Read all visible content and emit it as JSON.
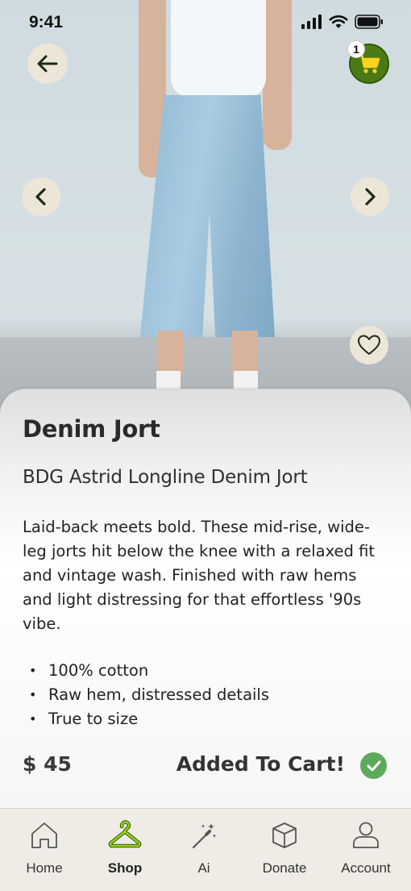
{
  "status_bar": {
    "time": "9:41"
  },
  "header": {
    "cart_count": "1"
  },
  "product": {
    "title": "Denim Jort",
    "name": "BDG Astrid Longline Denim Jort",
    "description": "Laid-back meets bold. These mid-rise, wide-leg jorts hit below the knee with a relaxed fit and vintage wash. Finished with raw hems and light distressing for that effortless '90s vibe.",
    "features": [
      "100% cotton",
      "Raw hem, distressed details",
      "True to size"
    ],
    "price": "$ 45",
    "cart_status": "Added To Cart!",
    "favorited": false
  },
  "icons": {
    "back": "arrow-left-icon",
    "prev": "chevron-left-icon",
    "next": "chevron-right-icon",
    "cart": "shopping-cart-icon",
    "favorite": "heart-icon",
    "added": "check-circle-icon"
  },
  "nav": {
    "active": "Shop",
    "items": [
      {
        "label": "Home",
        "icon": "home-icon"
      },
      {
        "label": "Shop",
        "icon": "hanger-icon"
      },
      {
        "label": "Ai",
        "icon": "magic-wand-icon"
      },
      {
        "label": "Donate",
        "icon": "box-icon"
      },
      {
        "label": "Account",
        "icon": "user-icon"
      }
    ]
  },
  "colors": {
    "accent_green": "#4b7a14",
    "hanger_green": "#9bd11d",
    "check_green": "#5daa5b",
    "button_beige": "#ece6d9",
    "nav_bg": "#efece6"
  }
}
